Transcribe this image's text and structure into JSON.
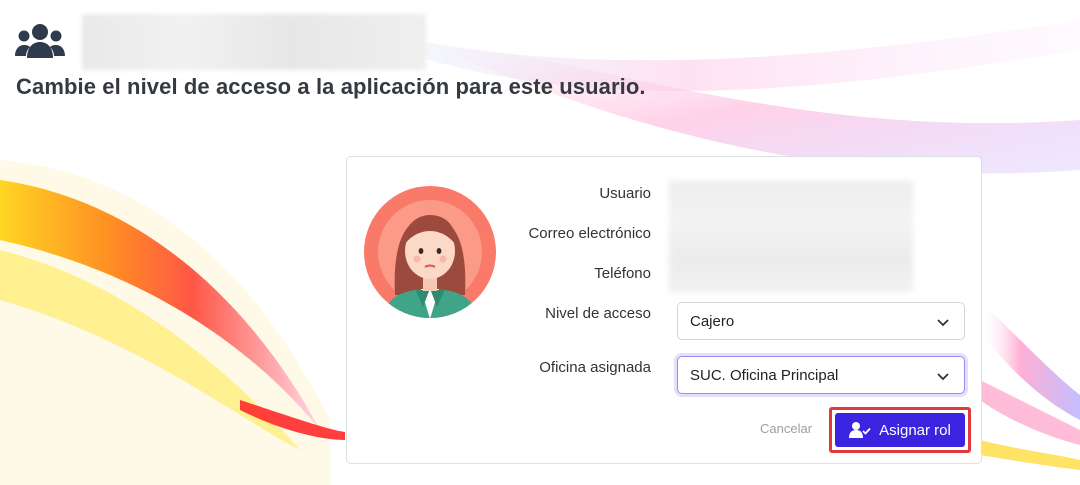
{
  "header": {
    "icon": "users-icon",
    "subtitle": "Cambie el nivel de acceso a la aplicación para este usuario."
  },
  "card": {
    "avatar": "woman-avatar",
    "labels": {
      "usuario": "Usuario",
      "correo": "Correo electrónico",
      "telefono": "Teléfono",
      "nivel": "Nivel de acceso",
      "oficina": "Oficina asignada"
    },
    "nivel_value": "Cajero",
    "oficina_value": "SUC. Oficina Principal",
    "cancel_label": "Cancelar",
    "assign_label": "Asignar rol"
  },
  "colors": {
    "primary": "#3a24e0",
    "highlight": "#e03a3e",
    "text": "#343a40"
  }
}
